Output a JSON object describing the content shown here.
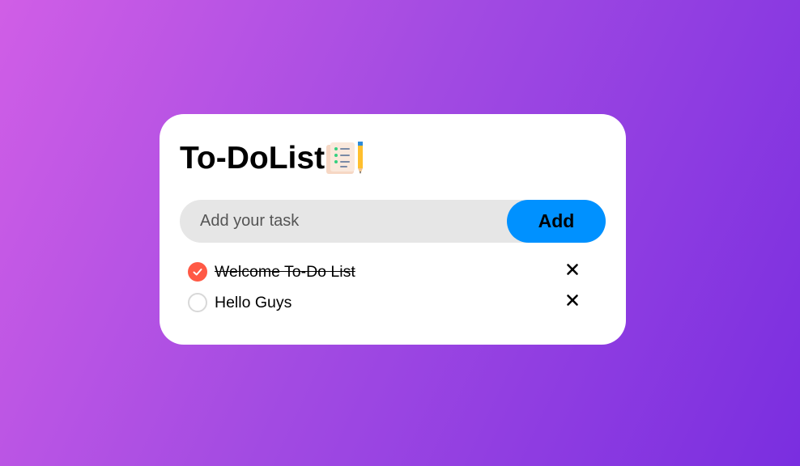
{
  "app": {
    "title": "To-DoList",
    "title_icon": "notepad-with-pencil-icon"
  },
  "input": {
    "placeholder": "Add your task",
    "value": ""
  },
  "add_button": {
    "label": "Add"
  },
  "tasks": [
    {
      "text": "Welcome To-Do List",
      "checked": true
    },
    {
      "text": "Hello Guys",
      "checked": false
    }
  ],
  "icons": {
    "checked": "check-icon",
    "unchecked": "empty-circle-icon",
    "delete": "close-icon"
  },
  "colors": {
    "accent": "#0091ff",
    "checked": "#ff5945",
    "card": "#ffffff",
    "input_bg": "#e6e6e6",
    "gradient_start": "#d05ee6",
    "gradient_end": "#7a2ee0"
  }
}
